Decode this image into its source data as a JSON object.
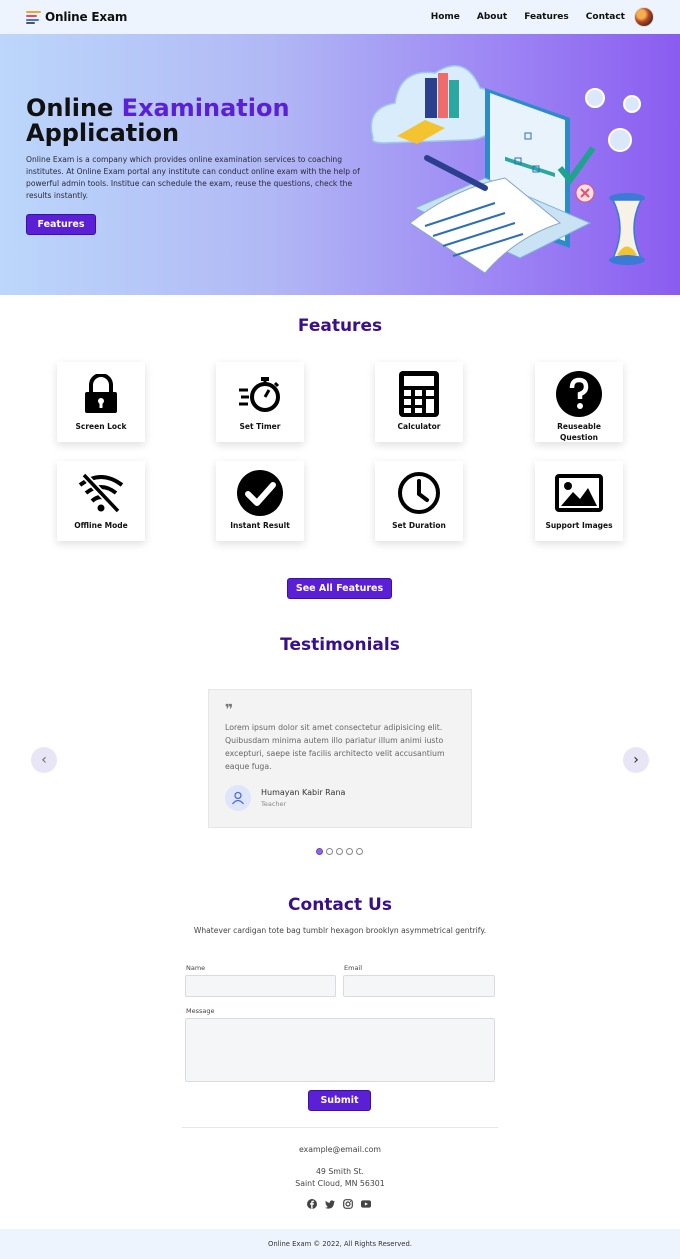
{
  "nav": {
    "brand": "Online Exam",
    "links": [
      "Home",
      "About",
      "Features",
      "Contact"
    ],
    "avatar_icon": "user-avatar"
  },
  "hero": {
    "title_plain": "Online ",
    "title_accent": "Examination",
    "title_line2": "Application",
    "description": "Online Exam is a company which provides online examination services to coaching institutes. At Online Exam portal any institute can conduct online exam with the help of powerful admin tools. Institue can schedule the exam, reuse the questions, check the results instantly.",
    "button": "Features",
    "accent_color": "#5b1fd6",
    "illustration": "isometric-exam-laptop-illustration"
  },
  "features": {
    "title": "Features",
    "items": [
      {
        "label": "Screen Lock",
        "icon": "lock-icon"
      },
      {
        "label": "Set Timer",
        "icon": "stopwatch-icon"
      },
      {
        "label": "Calculator",
        "icon": "calculator-icon"
      },
      {
        "label": "Reuseable Question",
        "icon": "question-circle-icon"
      },
      {
        "label": "Offline Mode",
        "icon": "wifi-off-icon"
      },
      {
        "label": "Instant Result",
        "icon": "check-circle-icon"
      },
      {
        "label": "Set Duration",
        "icon": "clock-icon"
      },
      {
        "label": "Support Images",
        "icon": "image-icon"
      }
    ],
    "see_all": "See All Features"
  },
  "testimonials": {
    "title": "Testimonials",
    "quote_mark": "❞",
    "text": "Lorem ipsum dolor sit amet consectetur adipisicing elit. Quibusdam minima autem illo pariatur illum animi iusto excepturi, saepe iste facilis architecto velit accusantium eaque fuga.",
    "name": "Humayan Kabir Rana",
    "role": "Teacher",
    "prev": "‹",
    "next": "›",
    "slides": 5,
    "active_slide": 0
  },
  "contact": {
    "title": "Contact Us",
    "subtitle": "Whatever cardigan tote bag tumblr hexagon brooklyn asymmetrical gentrify.",
    "name_label": "Name",
    "email_label": "Email",
    "message_label": "Message",
    "name_value": "",
    "email_value": "",
    "message_value": "",
    "submit": "Submit",
    "email": "example@email.com",
    "address_line1": "49 Smith St.",
    "address_line2": "Saint Cloud, MN 56301",
    "socials": [
      "facebook-icon",
      "twitter-icon",
      "instagram-icon",
      "youtube-icon"
    ]
  },
  "footer": {
    "copyright": "Online Exam © 2022, All Rights Reserved."
  }
}
